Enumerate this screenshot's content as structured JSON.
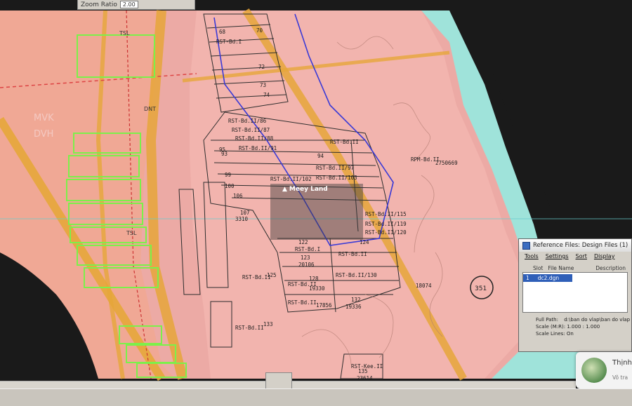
{
  "toolbar": {
    "zoom_label": "Zoom Ratio",
    "zoom_value": "2.00"
  },
  "map": {
    "zone_labels": [
      "MVK",
      "DVH",
      "TSL",
      "DNT",
      "TSL"
    ],
    "parcel_labels": [
      "RST-Bd.I",
      "RST-Bd.II/86",
      "RST-Bd.II/87",
      "RST-Bd.II/88",
      "RST-Bd.II/91",
      "RST-Bd.II",
      "RST-Bd.II/97",
      "RST-Bd.II/102",
      "RST-Bd.II/103",
      "RST-Bd.II/115",
      "RST-Bd.II/119",
      "RST-Bd.II/120",
      "RST-Bd.I",
      "RST-Bd.II",
      "RST-Bd.II",
      "RST-Bd.II",
      "RST-Bd.II/130",
      "RST-Bd.II",
      "RST-Bd.II",
      "RST-Kee.II",
      "RPM-Bd.II"
    ],
    "parcel_numbers": [
      "68",
      "70",
      "72",
      "73",
      "74",
      "93",
      "94",
      "95",
      "99",
      "100",
      "106",
      "107",
      "122",
      "123",
      "124",
      "125",
      "128",
      "132",
      "133",
      "135",
      "20106",
      "19330",
      "17856",
      "19336",
      "23614",
      "2750669",
      "18074",
      "3310",
      "351"
    ],
    "circle_label": "351",
    "watermark": "Meey Land"
  },
  "reference_window": {
    "title": "Reference Files: Design Files (1)",
    "menu": [
      "Tools",
      "Settings",
      "Sort",
      "Display"
    ],
    "columns": [
      "Slot",
      "File Name",
      "Description"
    ],
    "rows": [
      {
        "slot": "1",
        "file": "dc2.dgn"
      }
    ],
    "full_path_label": "Full Path:",
    "full_path": "d:\\ban do vlap\\ban do vlap",
    "scale_label": "Scale (M:R):",
    "scale_value": "1.000 : 1.000",
    "scale_lines_label": "Scale Lines:",
    "scale_lines_value": "On"
  },
  "notification": {
    "name": "Thịnh",
    "subtitle": "Vô tra"
  },
  "colors": {
    "pink_zone": "#e9a5a0",
    "cyan_zone": "#9fe3da",
    "dark_bg": "#1a1a1a",
    "orange_road": "#e6a63a",
    "green_parcels": "#7cf04a",
    "parcel_lines": "#2d2d2d",
    "blue_line": "#3a3ad6"
  }
}
